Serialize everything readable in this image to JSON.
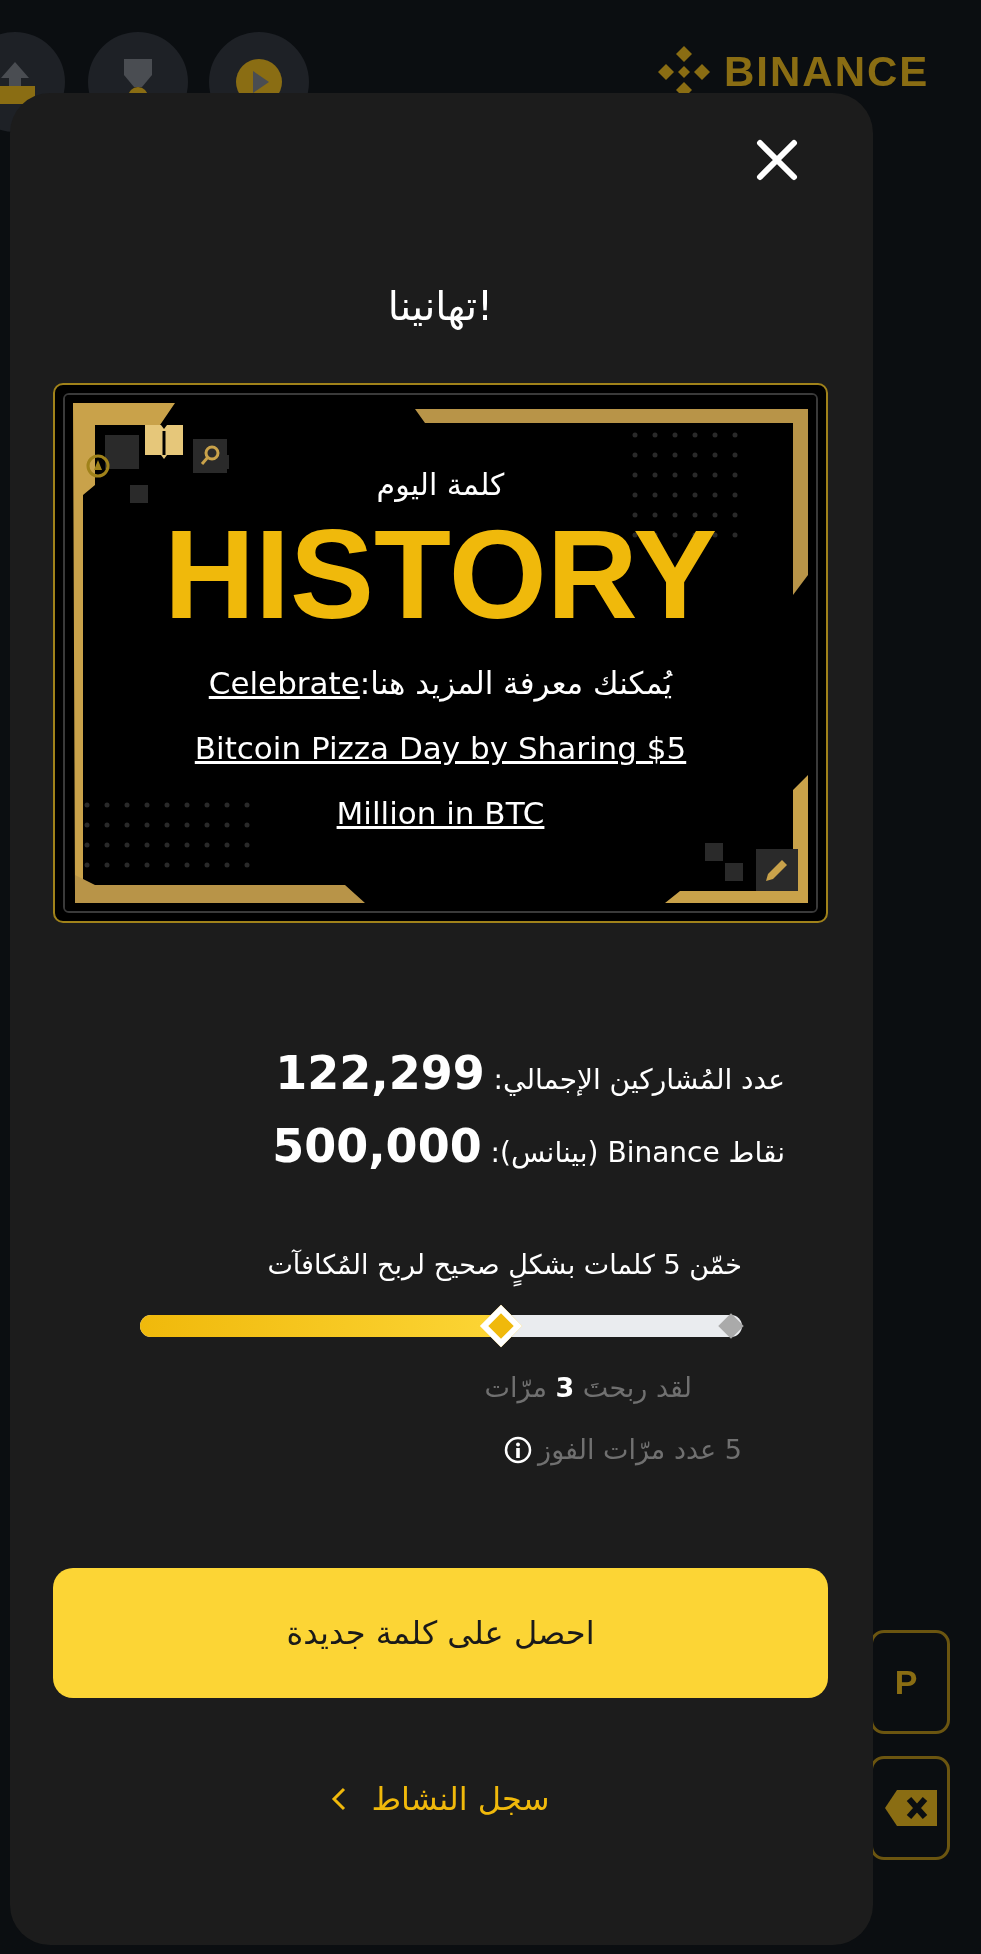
{
  "background": {
    "brand": "BINANCE",
    "keys": [
      {
        "kind": "letter",
        "label": "P"
      },
      {
        "kind": "backspace"
      }
    ]
  },
  "dialog": {
    "title": "تهانينا!",
    "word_card": {
      "caption": "كلمة اليوم",
      "word": "HISTORY",
      "prompt": "يُمكنك معرفة المزيد هنا:",
      "link_lines": [
        "Celebrate",
        "Bitcoin Pizza Day by Sharing $5",
        "Million in BTC"
      ]
    },
    "stats": [
      "عدد المُشاركين الإجمالي: **122,299**",
      "نقاط Binance (بينانس): **500,000**"
    ],
    "progress": {
      "label": "خمّن 5 كلمات بشكلٍ صحيح لربح المُكافآت",
      "level": 0.6,
      "won": "لقد ربحتَ **3** مرّات",
      "total": "5 عدد مرّات الفوز"
    },
    "primary_button": "احصل على كلمة جديدة",
    "history_link": "سجل النشاط"
  }
}
